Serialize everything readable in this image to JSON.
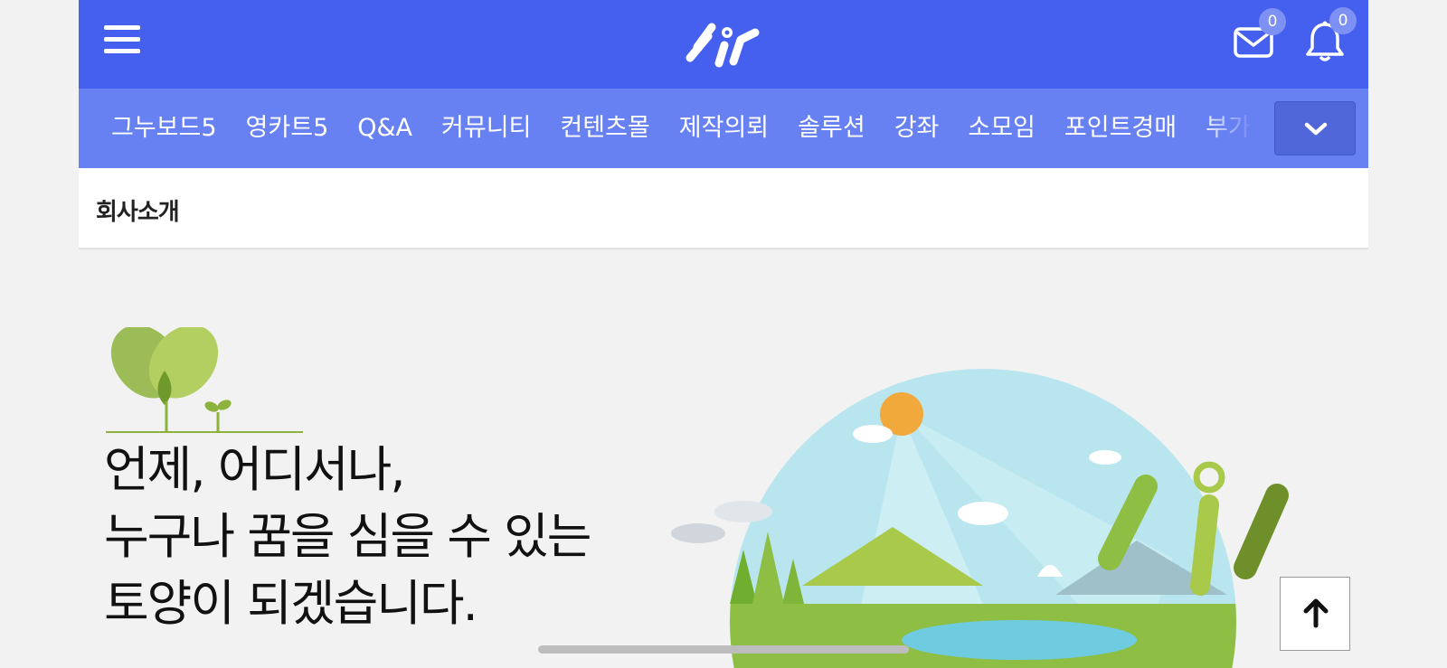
{
  "header": {
    "logo_text": "sir",
    "mail_count": "0",
    "notification_count": "0"
  },
  "nav": {
    "items": [
      "그누보드5",
      "영카트5",
      "Q&A",
      "커뮤니티",
      "컨텐츠몰",
      "제작의뢰",
      "솔루션",
      "강좌",
      "소모임",
      "포인트경매",
      "부가"
    ]
  },
  "page": {
    "section_title": "회사소개"
  },
  "hero": {
    "headline": [
      "언제, 어디서나,",
      "누구나 꿈을 심을 수 있는",
      "토양이 되겠습니다."
    ]
  },
  "colors": {
    "brand_blue": "#4560ef",
    "nav_blue": "#6780f2",
    "leaf_green": "#8eb33c"
  },
  "icons": [
    "menu-icon",
    "mail-icon",
    "bell-icon",
    "chevron-down-icon",
    "arrow-up-icon"
  ]
}
